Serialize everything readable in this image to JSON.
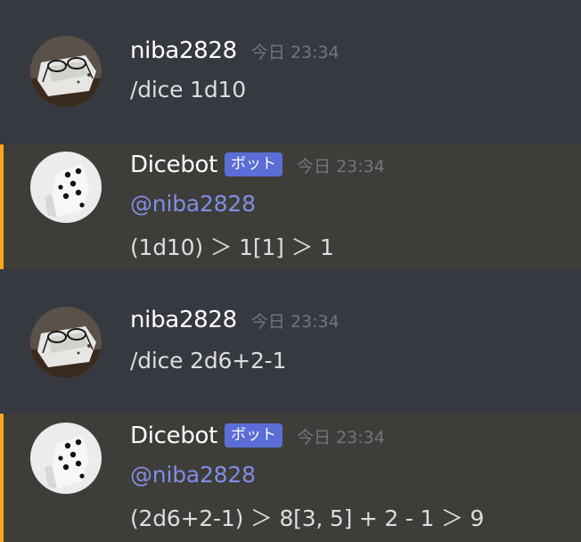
{
  "messages": [
    {
      "username": "niba2828",
      "timestamp": "今日 23:34",
      "content": "/dice 1d10"
    },
    {
      "username": "Dicebot",
      "bot_tag": "ボット",
      "timestamp": "今日 23:34",
      "mention": "@niba2828",
      "content": "(1d10) ＞ 1[1] ＞ 1"
    },
    {
      "username": "niba2828",
      "timestamp": "今日 23:34",
      "content": "/dice 2d6+2-1"
    },
    {
      "username": "Dicebot",
      "bot_tag": "ボット",
      "timestamp": "今日 23:34",
      "mention": "@niba2828",
      "content": "(2d6+2-1) ＞ 8[3, 5] + 2 - 1 ＞ 9"
    }
  ],
  "colors": {
    "background": "#36393f",
    "mention_highlight": "#3f3d39",
    "mention_bar": "#faa61a",
    "bot_tag": "#5b6dd6",
    "mention_text": "#7f8ee3",
    "username": "#ffffff",
    "timestamp": "#72767d"
  },
  "icons": {
    "user_avatar": "glasses-photo-avatar",
    "bot_avatar": "dice-avatar"
  }
}
